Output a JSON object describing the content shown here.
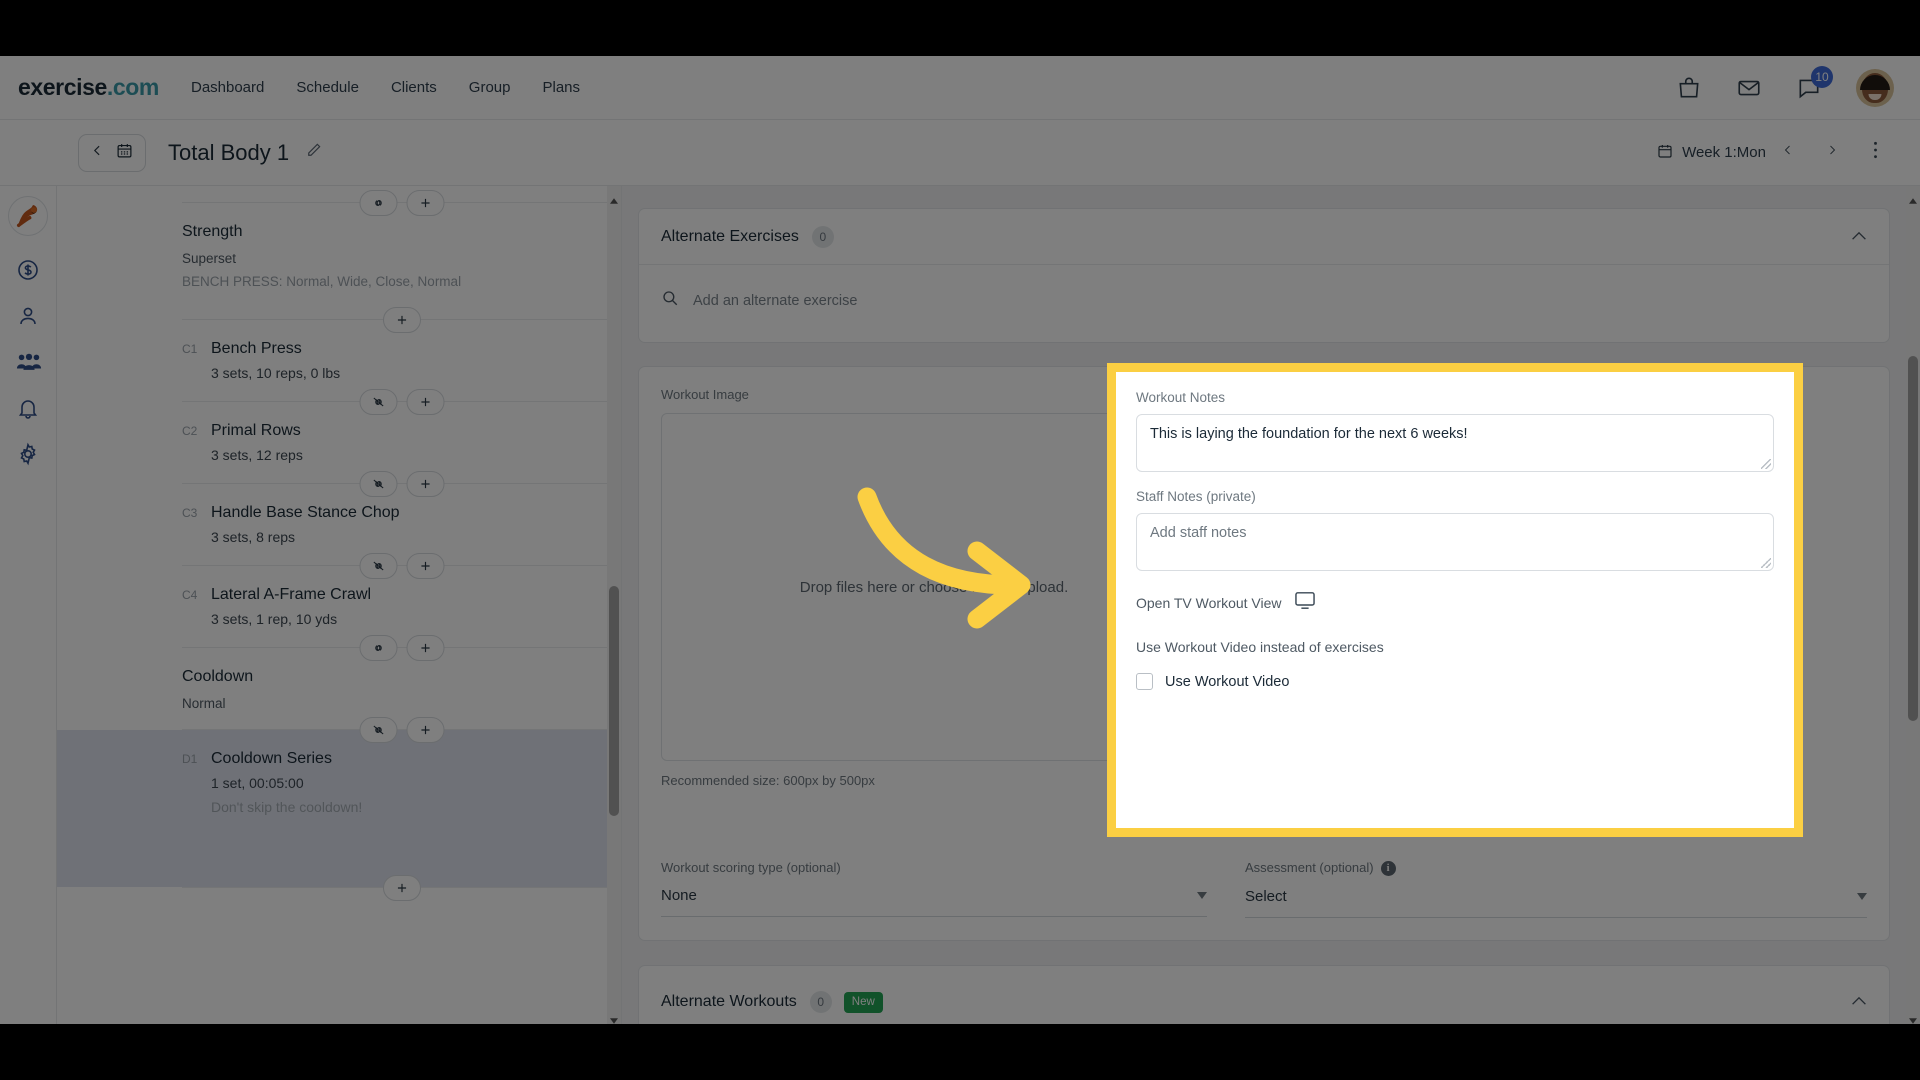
{
  "brand": {
    "name": "exercise",
    "suffix": ".com"
  },
  "topnav": {
    "links": [
      "Dashboard",
      "Schedule",
      "Clients",
      "Group",
      "Plans"
    ],
    "icons": [
      "shopping-bag-icon",
      "envelope-icon",
      "chat-bubble-icon"
    ],
    "chat_badge": "10"
  },
  "subheader": {
    "title": "Total Body 1",
    "back_icon": "chevron-left-icon",
    "calendar_icon": "calendar-icon",
    "edit_icon": "pencil-icon",
    "week_label": "Week 1:Mon",
    "prev_icon": "chevron-left-icon",
    "next_icon": "chevron-right-icon",
    "more_icon": "vertical-dots-icon"
  },
  "rail": {
    "items": [
      {
        "name": "logo",
        "icon": "kettlebell-logo-icon"
      },
      {
        "name": "billing",
        "icon": "dollar-circle-icon"
      },
      {
        "name": "clients",
        "icon": "person-icon"
      },
      {
        "name": "groups",
        "icon": "people-group-icon"
      },
      {
        "name": "notifications",
        "icon": "bell-icon"
      },
      {
        "name": "settings",
        "icon": "gear-icon"
      }
    ]
  },
  "workout_builder": {
    "sections": [
      {
        "kind": "divider",
        "buttons": [
          "link-icon",
          "plus-icon"
        ]
      },
      {
        "kind": "group",
        "title": "Strength",
        "subtitle": "Superset",
        "note": "BENCH PRESS: Normal, Wide, Close, Normal"
      },
      {
        "kind": "divider",
        "buttons": [
          "plus-icon"
        ]
      },
      {
        "kind": "exercise",
        "tag": "C1",
        "name": "Bench Press",
        "meta": "3 sets, 10 reps, 0 lbs"
      },
      {
        "kind": "divider",
        "buttons": [
          "unlink-icon",
          "plus-icon"
        ]
      },
      {
        "kind": "exercise",
        "tag": "C2",
        "name": "Primal Rows",
        "meta": "3 sets, 12 reps"
      },
      {
        "kind": "divider",
        "buttons": [
          "unlink-icon",
          "plus-icon"
        ]
      },
      {
        "kind": "exercise",
        "tag": "C3",
        "name": "Handle Base Stance Chop",
        "meta": "3 sets, 8 reps"
      },
      {
        "kind": "divider",
        "buttons": [
          "unlink-icon",
          "plus-icon"
        ]
      },
      {
        "kind": "exercise",
        "tag": "C4",
        "name": "Lateral A-Frame Crawl",
        "meta": "3 sets, 1 rep, 10 yds"
      },
      {
        "kind": "divider",
        "buttons": [
          "link-icon",
          "plus-icon"
        ]
      },
      {
        "kind": "group",
        "title": "Cooldown",
        "subtitle": "Normal"
      },
      {
        "kind": "divider",
        "buttons": [
          "unlink-icon",
          "plus-icon"
        ]
      },
      {
        "kind": "exercise",
        "tag": "D1",
        "name": "Cooldown Series",
        "meta": "1 set, 00:05:00",
        "note": "Don't skip the cooldown!",
        "selected": true
      },
      {
        "kind": "divider",
        "buttons": [
          "plus-icon"
        ]
      }
    ]
  },
  "alternate_exercises": {
    "title": "Alternate Exercises",
    "count": "0",
    "collapse_icon": "chevron-up-icon",
    "search_icon": "search-icon",
    "search_placeholder": "Add an alternate exercise"
  },
  "workout_image": {
    "label": "Workout Image",
    "dropzone_text": "Drop files here or choose files to upload.",
    "recommendation": "Recommended size: 600px by 500px"
  },
  "scoring": {
    "label": "Workout scoring type (optional)",
    "value": "None",
    "caret_icon": "caret-down-icon"
  },
  "assessment": {
    "label": "Assessment (optional)",
    "info_icon": "info-icon",
    "value": "Select",
    "caret_icon": "caret-down-icon"
  },
  "alternate_workouts": {
    "title": "Alternate Workouts",
    "count": "0",
    "badge": "New",
    "collapse_icon": "chevron-up-icon"
  },
  "callout": {
    "border_color": "#fbcf43",
    "workout_notes": {
      "label": "Workout Notes",
      "value": "This is laying the foundation for the next 6 weeks!"
    },
    "staff_notes": {
      "label": "Staff Notes (private)",
      "placeholder": "Add staff notes"
    },
    "tv_view": {
      "label": "Open TV Workout View",
      "icon": "monitor-icon"
    },
    "use_video": {
      "label": "Use Workout Video instead of exercises",
      "checkbox_label": "Use Workout Video",
      "checked": false
    }
  },
  "annotation": {
    "arrow_color": "#fbcf43",
    "icon": "curved-arrow-right-icon"
  }
}
